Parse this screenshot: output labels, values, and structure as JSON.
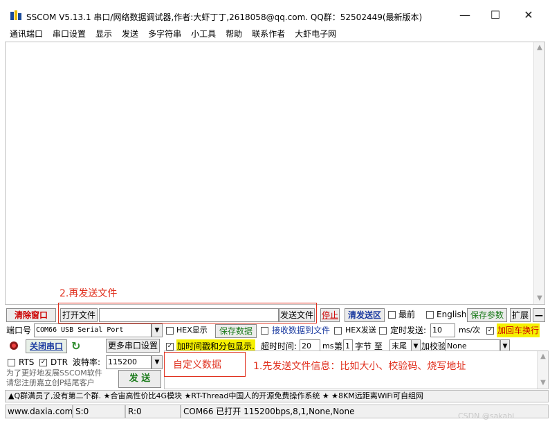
{
  "window": {
    "title": "SSCOM V5.13.1 串口/网络数据调试器,作者:大虾丁丁,2618058@qq.com. QQ群：52502449(最新版本)",
    "min_glyph": "—",
    "max_glyph": "☐",
    "close_glyph": "✕"
  },
  "menu": [
    "通讯端口",
    "串口设置",
    "显示",
    "发送",
    "多字符串",
    "小工具",
    "帮助",
    "联系作者",
    "大虾电子网"
  ],
  "annotations": {
    "step2": "2.再发送文件",
    "step1": "1.先发送文件信息：比如大小、校验码、烧写地址",
    "custom": "自定义数据"
  },
  "row1": {
    "clear_window": "清除窗口",
    "open_file": "打开文件",
    "file_path": "",
    "send_file": "发送文件",
    "stop": "停止",
    "clear_send": "清发送区",
    "topmost": "最前",
    "english": "English",
    "save_params": "保存参数",
    "expand": "扩展",
    "collapse": "—"
  },
  "row2": {
    "port_label": "端口号",
    "port_value": "COM66 USB Serial Port",
    "hex_display": "HEX显示",
    "save_data": "保存数据",
    "recv_to_file": "接收数据到文件",
    "hex_send": "HEX发送",
    "timed_send": "定时发送:",
    "interval": "10",
    "interval_unit": "ms/次",
    "append_newline": "加回车换行"
  },
  "row3": {
    "close_port": "关闭串口",
    "more_settings": "更多串口设置",
    "timestamp": "加时间戳和分包显示.",
    "timeout_label": "超时时间:",
    "timeout_value": "20",
    "timeout_unit": "ms",
    "byte_label_a": "第",
    "byte_index": "1",
    "byte_label_b": "字节 至",
    "byte_end": "末尾",
    "checksum_label": "加校验",
    "checksum_value": "None"
  },
  "row4": {
    "rts": "RTS",
    "dtr": "DTR",
    "baud_label": "波特率:",
    "baud_value": "115200"
  },
  "promo": {
    "line1": "为了更好地发展SSCOM软件",
    "line2": "请您注册嘉立创P结尾客户",
    "send": "发 送"
  },
  "marquee": "▲Q群满员了,没有第二个群. ★合宙高性价比4G模块 ★RT-Thread中国人的开源免费操作系统 ★ ★8KM远距离WiFi可自组网",
  "status": {
    "site": "www.daxia.com",
    "sent": "S:0",
    "recv": "R:0",
    "port_state": "COM66 已打开  115200bps,8,1,None,None"
  },
  "watermark": "CSDN @sakabi"
}
